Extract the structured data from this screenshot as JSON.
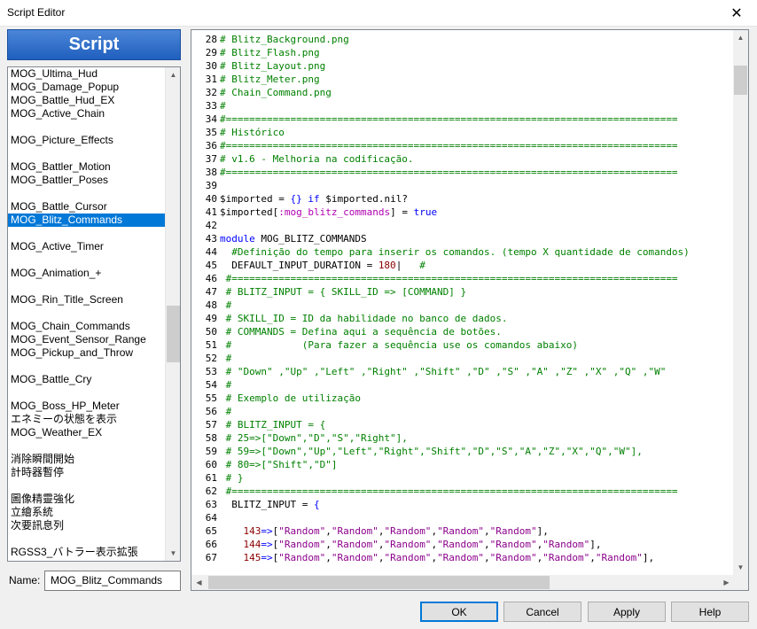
{
  "window": {
    "title": "Script Editor",
    "close_glyph": "✕"
  },
  "sidebar": {
    "header": "Script",
    "items": [
      {
        "label": "MOG_Ultima_Hud",
        "selected": false
      },
      {
        "label": "MOG_Damage_Popup",
        "selected": false
      },
      {
        "label": "MOG_Battle_Hud_EX",
        "selected": false
      },
      {
        "label": "MOG_Active_Chain",
        "selected": false
      },
      {
        "label": "",
        "selected": false
      },
      {
        "label": "MOG_Picture_Effects",
        "selected": false
      },
      {
        "label": "",
        "selected": false
      },
      {
        "label": "MOG_Battler_Motion",
        "selected": false
      },
      {
        "label": "MOG_Battler_Poses",
        "selected": false
      },
      {
        "label": "",
        "selected": false
      },
      {
        "label": "MOG_Battle_Cursor",
        "selected": false
      },
      {
        "label": "MOG_Blitz_Commands",
        "selected": true
      },
      {
        "label": "",
        "selected": false
      },
      {
        "label": "MOG_Active_Timer",
        "selected": false
      },
      {
        "label": "",
        "selected": false
      },
      {
        "label": "MOG_Animation_+",
        "selected": false
      },
      {
        "label": "",
        "selected": false
      },
      {
        "label": "MOG_Rin_Title_Screen",
        "selected": false
      },
      {
        "label": "",
        "selected": false
      },
      {
        "label": "MOG_Chain_Commands",
        "selected": false
      },
      {
        "label": "MOG_Event_Sensor_Range",
        "selected": false
      },
      {
        "label": "MOG_Pickup_and_Throw",
        "selected": false
      },
      {
        "label": "",
        "selected": false
      },
      {
        "label": "MOG_Battle_Cry",
        "selected": false
      },
      {
        "label": "",
        "selected": false
      },
      {
        "label": "MOG_Boss_HP_Meter",
        "selected": false
      },
      {
        "label": "エネミーの状態を表示",
        "selected": false
      },
      {
        "label": "MOG_Weather_EX",
        "selected": false
      },
      {
        "label": "",
        "selected": false
      },
      {
        "label": "消除瞬間開始",
        "selected": false
      },
      {
        "label": "計時器暫停",
        "selected": false
      },
      {
        "label": "",
        "selected": false
      },
      {
        "label": "圖像精靈強化",
        "selected": false
      },
      {
        "label": "立繪系統",
        "selected": false
      },
      {
        "label": "次要訊息列",
        "selected": false
      },
      {
        "label": "",
        "selected": false
      },
      {
        "label": "RGSS3_バトラー表示拡張",
        "selected": false
      }
    ],
    "scroll_fraction": 0.55
  },
  "name_field": {
    "label": "Name:",
    "value": "MOG_Blitz_Commands"
  },
  "editor": {
    "lines": [
      {
        "n": "28",
        "parts": [
          [
            "cm",
            "# Blitz_Background.png"
          ]
        ]
      },
      {
        "n": "29",
        "parts": [
          [
            "cm",
            "# Blitz_Flash.png"
          ]
        ]
      },
      {
        "n": "30",
        "parts": [
          [
            "cm",
            "# Blitz_Layout.png"
          ]
        ]
      },
      {
        "n": "31",
        "parts": [
          [
            "cm",
            "# Blitz_Meter.png"
          ]
        ]
      },
      {
        "n": "32",
        "parts": [
          [
            "cm",
            "# Chain_Command.png"
          ]
        ]
      },
      {
        "n": "33",
        "parts": [
          [
            "cm",
            "#"
          ]
        ]
      },
      {
        "n": "34",
        "parts": [
          [
            "cm",
            "#============================================================================="
          ]
        ]
      },
      {
        "n": "35",
        "parts": [
          [
            "cm",
            "# Histórico"
          ]
        ]
      },
      {
        "n": "36",
        "parts": [
          [
            "cm",
            "#============================================================================="
          ]
        ]
      },
      {
        "n": "37",
        "parts": [
          [
            "cm",
            "# v1.6 - Melhoria na codificação."
          ]
        ]
      },
      {
        "n": "38",
        "parts": [
          [
            "cm",
            "#============================================================================="
          ]
        ]
      },
      {
        "n": "39",
        "parts": []
      },
      {
        "n": "40",
        "parts": [
          [
            "plain",
            "$imported = "
          ],
          [
            "kw",
            "{}"
          ],
          [
            "plain",
            " "
          ],
          [
            "kw",
            "if"
          ],
          [
            "plain",
            " $imported.nil?"
          ]
        ]
      },
      {
        "n": "41",
        "parts": [
          [
            "plain",
            "$imported["
          ],
          [
            "sym",
            ":mog_blitz_commands"
          ],
          [
            "plain",
            "] = "
          ],
          [
            "kw",
            "true"
          ]
        ]
      },
      {
        "n": "42",
        "parts": []
      },
      {
        "n": "43",
        "parts": [
          [
            "kw",
            "module"
          ],
          [
            "plain",
            " MOG_BLITZ_COMMANDS"
          ]
        ]
      },
      {
        "n": "44",
        "parts": [
          [
            "cm",
            "  #Definição do tempo para inserir os comandos. (tempo X quantidade de comandos)"
          ]
        ]
      },
      {
        "n": "45",
        "parts": [
          [
            "plain",
            "  DEFAULT_INPUT_DURATION = "
          ],
          [
            "num",
            "180"
          ],
          [
            "plain",
            "|   "
          ],
          [
            "cm",
            "#"
          ]
        ]
      },
      {
        "n": "46",
        "parts": [
          [
            "cm",
            " #============================================================================"
          ]
        ]
      },
      {
        "n": "47",
        "parts": [
          [
            "cm",
            " # BLITZ_INPUT = { SKILL_ID => [COMMAND] }"
          ]
        ]
      },
      {
        "n": "48",
        "parts": [
          [
            "cm",
            " #"
          ]
        ]
      },
      {
        "n": "49",
        "parts": [
          [
            "cm",
            " # SKILL_ID = ID da habilidade no banco de dados."
          ]
        ]
      },
      {
        "n": "50",
        "parts": [
          [
            "cm",
            " # COMMANDS = Defina aqui a sequência de botões."
          ]
        ]
      },
      {
        "n": "51",
        "parts": [
          [
            "cm",
            " #            (Para fazer a sequência use os comandos abaixo)"
          ]
        ]
      },
      {
        "n": "52",
        "parts": [
          [
            "cm",
            " #"
          ]
        ]
      },
      {
        "n": "53",
        "parts": [
          [
            "cm",
            " # \"Down\" ,\"Up\" ,\"Left\" ,\"Right\" ,\"Shift\" ,\"D\" ,\"S\" ,\"A\" ,\"Z\" ,\"X\" ,\"Q\" ,\"W\""
          ]
        ]
      },
      {
        "n": "54",
        "parts": [
          [
            "cm",
            " #"
          ]
        ]
      },
      {
        "n": "55",
        "parts": [
          [
            "cm",
            " # Exemplo de utilização"
          ]
        ]
      },
      {
        "n": "56",
        "parts": [
          [
            "cm",
            " #"
          ]
        ]
      },
      {
        "n": "57",
        "parts": [
          [
            "cm",
            " # BLITZ_INPUT = {"
          ]
        ]
      },
      {
        "n": "58",
        "parts": [
          [
            "cm",
            " # 25=>[\"Down\",\"D\",\"S\",\"Right\"],"
          ]
        ]
      },
      {
        "n": "59",
        "parts": [
          [
            "cm",
            " # 59=>[\"Down\",\"Up\",\"Left\",\"Right\",\"Shift\",\"D\",\"S\",\"A\",\"Z\",\"X\",\"Q\",\"W\"],"
          ]
        ]
      },
      {
        "n": "60",
        "parts": [
          [
            "cm",
            " # 80=>[\"Shift\",\"D\"]"
          ]
        ]
      },
      {
        "n": "61",
        "parts": [
          [
            "cm",
            " # }"
          ]
        ]
      },
      {
        "n": "62",
        "parts": [
          [
            "cm",
            " #============================================================================"
          ]
        ]
      },
      {
        "n": "63",
        "parts": [
          [
            "plain",
            "  BLITZ_INPUT = "
          ],
          [
            "kw",
            "{"
          ]
        ]
      },
      {
        "n": "64",
        "parts": []
      },
      {
        "n": "65",
        "parts": [
          [
            "num",
            "    143"
          ],
          [
            "kw",
            "=>"
          ],
          [
            "plain",
            "["
          ],
          [
            "str",
            "\"Random\""
          ],
          [
            "plain",
            ","
          ],
          [
            "str",
            "\"Random\""
          ],
          [
            "plain",
            ","
          ],
          [
            "str",
            "\"Random\""
          ],
          [
            "plain",
            ","
          ],
          [
            "str",
            "\"Random\""
          ],
          [
            "plain",
            ","
          ],
          [
            "str",
            "\"Random\""
          ],
          [
            "plain",
            "],"
          ]
        ]
      },
      {
        "n": "66",
        "parts": [
          [
            "num",
            "    144"
          ],
          [
            "kw",
            "=>"
          ],
          [
            "plain",
            "["
          ],
          [
            "str",
            "\"Random\""
          ],
          [
            "plain",
            ","
          ],
          [
            "str",
            "\"Random\""
          ],
          [
            "plain",
            ","
          ],
          [
            "str",
            "\"Random\""
          ],
          [
            "plain",
            ","
          ],
          [
            "str",
            "\"Random\""
          ],
          [
            "plain",
            ","
          ],
          [
            "str",
            "\"Random\""
          ],
          [
            "plain",
            ","
          ],
          [
            "str",
            "\"Random\""
          ],
          [
            "plain",
            "],"
          ]
        ]
      },
      {
        "n": "67",
        "parts": [
          [
            "num",
            "    145"
          ],
          [
            "kw",
            "=>"
          ],
          [
            "plain",
            "["
          ],
          [
            "str",
            "\"Random\""
          ],
          [
            "plain",
            ","
          ],
          [
            "str",
            "\"Random\""
          ],
          [
            "plain",
            ","
          ],
          [
            "str",
            "\"Random\""
          ],
          [
            "plain",
            ","
          ],
          [
            "str",
            "\"Random\""
          ],
          [
            "plain",
            ","
          ],
          [
            "str",
            "\"Random\""
          ],
          [
            "plain",
            ","
          ],
          [
            "str",
            "\"Random\""
          ],
          [
            "plain",
            ","
          ],
          [
            "str",
            "\"Random\""
          ],
          [
            "plain",
            "],"
          ]
        ]
      }
    ]
  },
  "buttons": {
    "ok": "OK",
    "cancel": "Cancel",
    "apply": "Apply",
    "help": "Help"
  }
}
